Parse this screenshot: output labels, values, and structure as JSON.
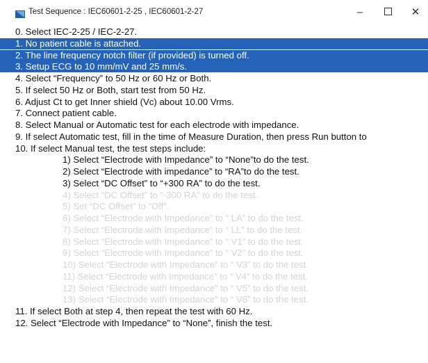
{
  "window": {
    "title": "Test Sequence : IEC60601-2-25 , IEC60601-2-27",
    "icon": "app-window-icon",
    "controls": {
      "minimize": "–",
      "close": "✕"
    }
  },
  "colors": {
    "selection": "#2563b9",
    "dim_text": "#d4d4d4"
  },
  "steps": [
    {
      "text": "0. Select IEC-2-25 / IEC-2-27.",
      "style": "normal"
    },
    {
      "text": "1. No patient cable is attached.",
      "style": "selected"
    },
    {
      "text": "2. The line frequency notch filter (if provided) is turned off.",
      "style": "selected"
    },
    {
      "text": "3. Setup ECG to 10 mm/mV and 25 mm/s.",
      "style": "selected"
    },
    {
      "text": "4. Select “Frequency” to 50 Hz or 60 Hz or Both.",
      "style": "normal"
    },
    {
      "text": "5. If select 50 Hz or Both, start test from 50 Hz.",
      "style": "normal"
    },
    {
      "text": "6. Adjust Ct to get Inner shield (Vc) about 10.00 Vrms.",
      "style": "normal"
    },
    {
      "text": "7. Connect patient cable.",
      "style": "normal"
    },
    {
      "text": "8. Select Manual or Automatic test for each electrode with impedance.",
      "style": "normal"
    },
    {
      "text": "9. If select Automatic test, fill in the time of Measure Duration, then press Run button to",
      "style": "normal"
    },
    {
      "text": "10. If select Manual test, the test steps include:",
      "style": "normal"
    },
    {
      "text": "1) Select  “Electrode with Impedance” to “None”to do the test.",
      "style": "sub"
    },
    {
      "text": "2) Select “Electrode with impedance” to “RA”to do the test.",
      "style": "sub"
    },
    {
      "text": "3) Select “DC Offset” to “+300 RA” to do the test.",
      "style": "sub"
    },
    {
      "text": "4) Select “DC Offset” to “-300 RA” to do the test.",
      "style": "sub-dim"
    },
    {
      "text": "5) Set “DC Offset” to “Off”.",
      "style": "sub-dim"
    },
    {
      "text": "6) Select “Electrode with Impedance” to “ LA” to do the test.",
      "style": "sub-dim"
    },
    {
      "text": "7) Select “Electrode with Impedance” to “ LL” to do the test.",
      "style": "sub-dim"
    },
    {
      "text": "8) Select “Electrode with Impedance” to “ V1” to do the test.",
      "style": "sub-dim"
    },
    {
      "text": "9) Select “Electrode with Impedance” to “ V2” to do the test.",
      "style": "sub-dim"
    },
    {
      "text": "10) Select “Electrode with Impedance” to “ V3” to do the test.",
      "style": "sub-dim"
    },
    {
      "text": "11) Select “Electrode with Impedance” to “ V4” to do the test.",
      "style": "sub-dim"
    },
    {
      "text": "12) Select “Electrode with Impedance” to “ V5” to do the test.",
      "style": "sub-dim"
    },
    {
      "text": "13) Select “Electrode with Impedance” to “ V6” to do the test.",
      "style": "sub-dim"
    },
    {
      "text": "11. If select Both at step 4, then repeat the test with 60 Hz.",
      "style": "normal"
    },
    {
      "text": "12. Select “Electrode with Impedance” to “None”, finish the test.",
      "style": "normal"
    }
  ]
}
